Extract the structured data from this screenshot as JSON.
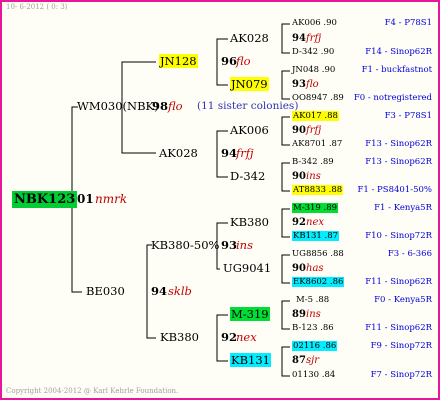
{
  "header": {
    "stamp": "10-  6-2012 (  0:  3)"
  },
  "footer": {
    "copyright": "Copyright 2004-2012 @ Karl Kehrle Foundation."
  },
  "root": {
    "id": "NBK123",
    "num": "01",
    "code": "nmrk"
  },
  "gen1": [
    {
      "id": "WM030(NBK)",
      "num": "98",
      "code": "flo",
      "note": "(11 sister colonies)"
    },
    {
      "id": "BE030",
      "num": "94",
      "code": "sklb"
    }
  ],
  "gen2": [
    {
      "id": "JN128",
      "num": "96",
      "code": "flo"
    },
    {
      "id": "AK028",
      "num": "94",
      "code": "frfj"
    },
    {
      "id": "KB380-50%",
      "num": "93",
      "code": "ins"
    },
    {
      "id": "KB380",
      "num": "92",
      "code": "nex"
    }
  ],
  "gen3": [
    {
      "id": "AK028"
    },
    {
      "id": "JN079"
    },
    {
      "id": "AK006"
    },
    {
      "id": "D-342"
    },
    {
      "id": "KB380"
    },
    {
      "id": "UG9041"
    },
    {
      "id": "M-319"
    },
    {
      "id": "KB131"
    }
  ],
  "gen4": [
    {
      "top": "AK006 .90",
      "num": "94",
      "code": "frfj",
      "bottom": "D-342 .90",
      "loc_top": "F4 - P78S1",
      "loc_bottom": "F14 - Sinop62R"
    },
    {
      "top": "JN048 .90",
      "num": "93",
      "code": "flo",
      "bottom": "OO8947 .89",
      "loc_top": "F1 - buckfastnot",
      "loc_bottom": "F0 - notregistered"
    },
    {
      "top": "AK017 .88",
      "num": "90",
      "code": "frfj",
      "bottom": "AK8701 .87",
      "loc_top": "F3 - P78S1",
      "loc_bottom": "F13 - Sinop62R"
    },
    {
      "top": "B-342 .89",
      "num": "90",
      "code": "ins",
      "bottom": "AT8833 .88",
      "loc_top": "F13 - Sinop62R",
      "loc_bottom": "F1 - PS8401-50%"
    },
    {
      "top": "M-319 .89",
      "num": "92",
      "code": "nex",
      "bottom": "KB131 .87",
      "loc_top": "F1 - Kenya5R",
      "loc_bottom": "F10 - Sinop72R"
    },
    {
      "top": "UG8856 .88",
      "num": "90",
      "code": "has",
      "bottom": "EK8602 .86",
      "loc_top": "F3 - 6-366",
      "loc_bottom": "F11 - Sinop62R"
    },
    {
      "top": "M-5 .88",
      "num": "89",
      "code": "ins",
      "bottom": "B-123 .86",
      "loc_top": "F0 - Kenya5R",
      "loc_bottom": "F11 - Sinop62R"
    },
    {
      "top": "02116 .86",
      "num": "87",
      "code": "sjr",
      "bottom": "01130 .84",
      "loc_top": "F9 - Sinop72R",
      "loc_bottom": "F7 - Sinop72R"
    }
  ],
  "colors": {
    "border": "#e8179a",
    "yellow": "#ffff00",
    "green": "#00dd33",
    "cyan": "#00eeff",
    "code_red": "#c00000"
  }
}
